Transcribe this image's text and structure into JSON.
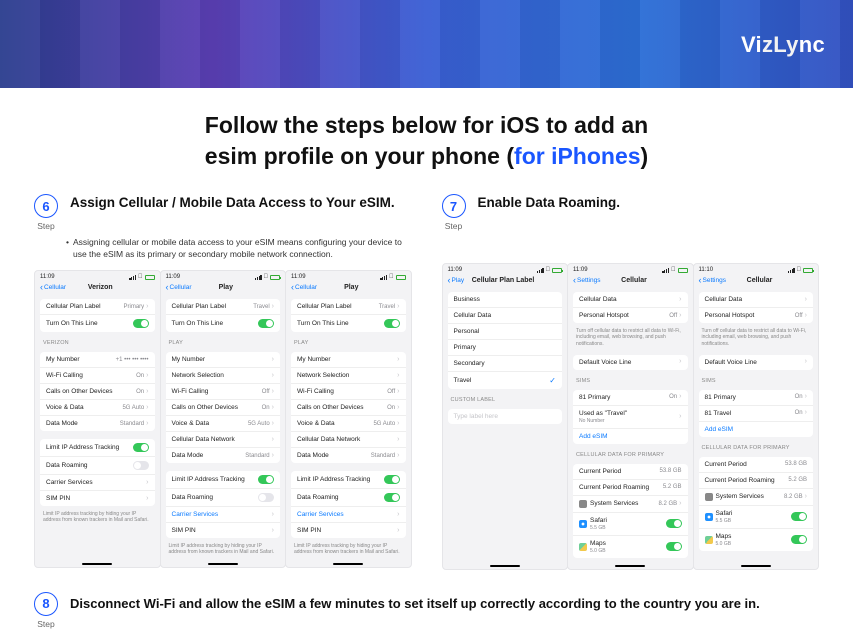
{
  "brand": "VizLync",
  "title_line1": "Follow the steps below for iOS to add an",
  "title_line2a": "esim profile on your phone (",
  "title_line2_accent": "for iPhones",
  "title_line2b": ")",
  "step_label": "Step",
  "step6": {
    "num": "6",
    "title": "Assign Cellular / Mobile Data Access to Your eSIM.",
    "desc": "Assigning cellular or mobile data access to your eSIM means configuring your device to use the eSIM as its primary or secondary mobile network connection."
  },
  "step7": {
    "num": "7",
    "title": "Enable Data Roaming."
  },
  "step8": {
    "num": "8",
    "title": "Disconnect Wi-Fi and allow the eSIM a few minutes to set itself up correctly according to the country you are in."
  },
  "labels": {
    "cellular": "Cellular",
    "play": "Play",
    "settings": "Settings",
    "cellular_plan_label_n": "Cellular Plan Label",
    "cellular_plan_label": "Cellular Plan Label",
    "turn_on": "Turn On This Line",
    "my_number": "My Number",
    "network_selection": "Network Selection",
    "wifi_calling": "Wi-Fi Calling",
    "calls_other": "Calls on Other Devices",
    "voice_data": "Voice & Data",
    "cellular_data_network": "Cellular Data Network",
    "data_mode": "Data Mode",
    "limit_ip": "Limit IP Address Tracking",
    "data_roaming": "Data Roaming",
    "carrier_services": "Carrier Services",
    "sim_pin": "SIM PIN",
    "business": "Business",
    "cellular_data": "Cellular Data",
    "personal": "Personal",
    "primary": "Primary",
    "secondary": "Secondary",
    "travel": "Travel",
    "custom_label": "CUSTOM LABEL",
    "type_label": "Type label here",
    "personal_hotspot": "Personal Hotspot",
    "default_voice_line": "Default Voice Line",
    "sims": "SIMs",
    "used_as": "Used as \"Travel\"",
    "no_number": "No Number",
    "add_esim": "Add eSIM",
    "cellular_data_primary": "CELLULAR DATA FOR PRIMARY",
    "current_period": "Current Period",
    "current_roaming": "Current Period Roaming",
    "system_services": "System Services",
    "safari": "Safari",
    "maps": "Maps",
    "verizon": "Verizon",
    "footnote_ip": "Limit IP address tracking by hiding your IP address from known trackers in Mail and Safari.",
    "hotspot_note": "Turn off cellular data to restrict all data to Wi-Fi, including email, web browsing, and push notifications."
  },
  "vals": {
    "primary": "Primary",
    "travel": "Travel",
    "on": "On",
    "off": "Off",
    "auto5g": "5G Auto",
    "standard": "Standard",
    "gb538": "53.8 GB",
    "gb52": "5.2 GB",
    "gb82": "8.2 GB",
    "gb55": "5.5 GB",
    "gb50": "5.0 GB",
    "sim1": "81 Primary",
    "sim2": "81 Travel"
  },
  "times": {
    "t1109": "11:09",
    "t1110": "11:10"
  }
}
